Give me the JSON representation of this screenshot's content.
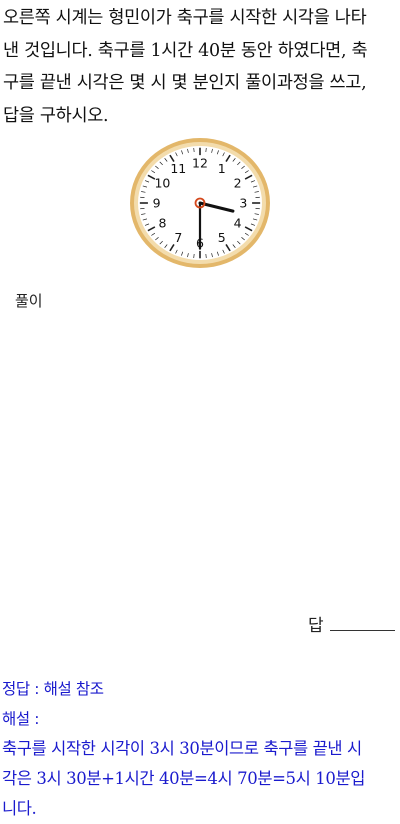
{
  "question": {
    "lines": [
      "오른쪽 시계는 형민이가 축구를 시작한 시각을 나타",
      "낸 것입니다. 축구를 1시간 40분 동안 하였다면, 축",
      "구를 끝낸 시각은 몇 시 몇 분인지 풀이과정을 쓰고,",
      "답을 구하시오."
    ]
  },
  "clock": {
    "numbers": [
      "12",
      "1",
      "2",
      "3",
      "4",
      "5",
      "6",
      "7",
      "8",
      "9",
      "10",
      "11"
    ],
    "time_shown": "3:30",
    "hour": 3,
    "minute": 30,
    "colors": {
      "rim": "#e3b76a",
      "face": "#ffffff",
      "hands": "#111111",
      "center": "#d4481c"
    }
  },
  "solution": {
    "label": "풀이"
  },
  "answer": {
    "label": "답"
  },
  "explanation": {
    "answer_line": "정답 : 해설 참조",
    "heading": "해설 :",
    "lines": [
      "축구를 시작한 시각이 3시 30분이므로 축구를 끝낸 시",
      "각은 3시 30분+1시간 40분=4시 70분=5시 10분입",
      "니다."
    ]
  }
}
